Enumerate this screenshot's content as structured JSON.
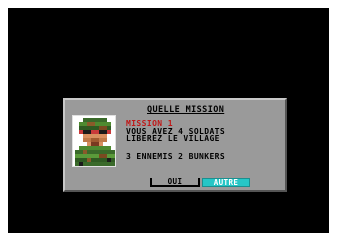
{
  "dialog": {
    "title": "QUELLE MISSION",
    "mission_name": "MISSION 1",
    "line1": "VOUS AVEZ 4 SOLDATS",
    "line2": "LIBEREZ LE VILLAGE",
    "counts": "3 ENNEMIS  2 BUNKERS",
    "buttons": {
      "oui": "OUI",
      "autre": "AUTRE"
    },
    "portrait_icon": "soldier-portrait-icon"
  },
  "colors": {
    "background": "#000000",
    "dialog": "#9a9a9a",
    "mission_name": "#c01818",
    "selected_button": "#26c6c6"
  }
}
